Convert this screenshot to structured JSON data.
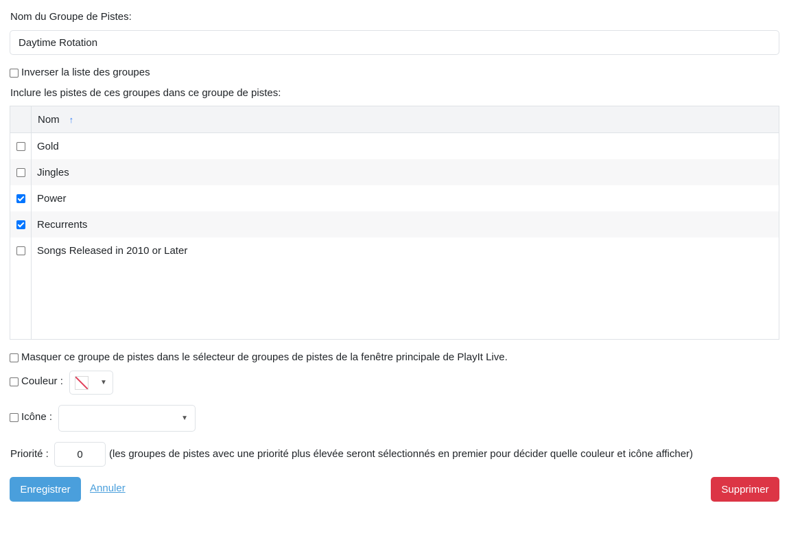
{
  "form": {
    "name_label": "Nom du Groupe de Pistes:",
    "name_value": "Daytime Rotation",
    "invert_label": "Inverser la liste des groupes",
    "invert_checked": false,
    "include_label": "Inclure les pistes de ces groupes dans ce groupe de pistes:"
  },
  "table": {
    "column_name": "Nom",
    "sort_icon": "arrow-up-icon",
    "rows": [
      {
        "name": "Gold",
        "checked": false
      },
      {
        "name": "Jingles",
        "checked": false
      },
      {
        "name": "Power",
        "checked": true
      },
      {
        "name": "Recurrents",
        "checked": true
      },
      {
        "name": "Songs Released in 2010 or Later",
        "checked": false
      }
    ]
  },
  "options": {
    "hide_label": "Masquer ce groupe de pistes dans le sélecteur de groupes de pistes de la fenêtre principale de PlayIt Live.",
    "color_label": "Couleur :",
    "icon_label": "Icône :",
    "priority_label": "Priorité :",
    "priority_value": "0",
    "priority_help": "(les groupes de pistes avec une priorité plus élevée seront sélectionnés en premier pour décider quelle couleur et icône afficher)"
  },
  "actions": {
    "save_label": "Enregistrer",
    "cancel_label": "Annuler",
    "delete_label": "Supprimer"
  },
  "colors": {
    "primary": "#4a9fdc",
    "danger": "#dc3545",
    "check_accent": "#0075ff"
  }
}
